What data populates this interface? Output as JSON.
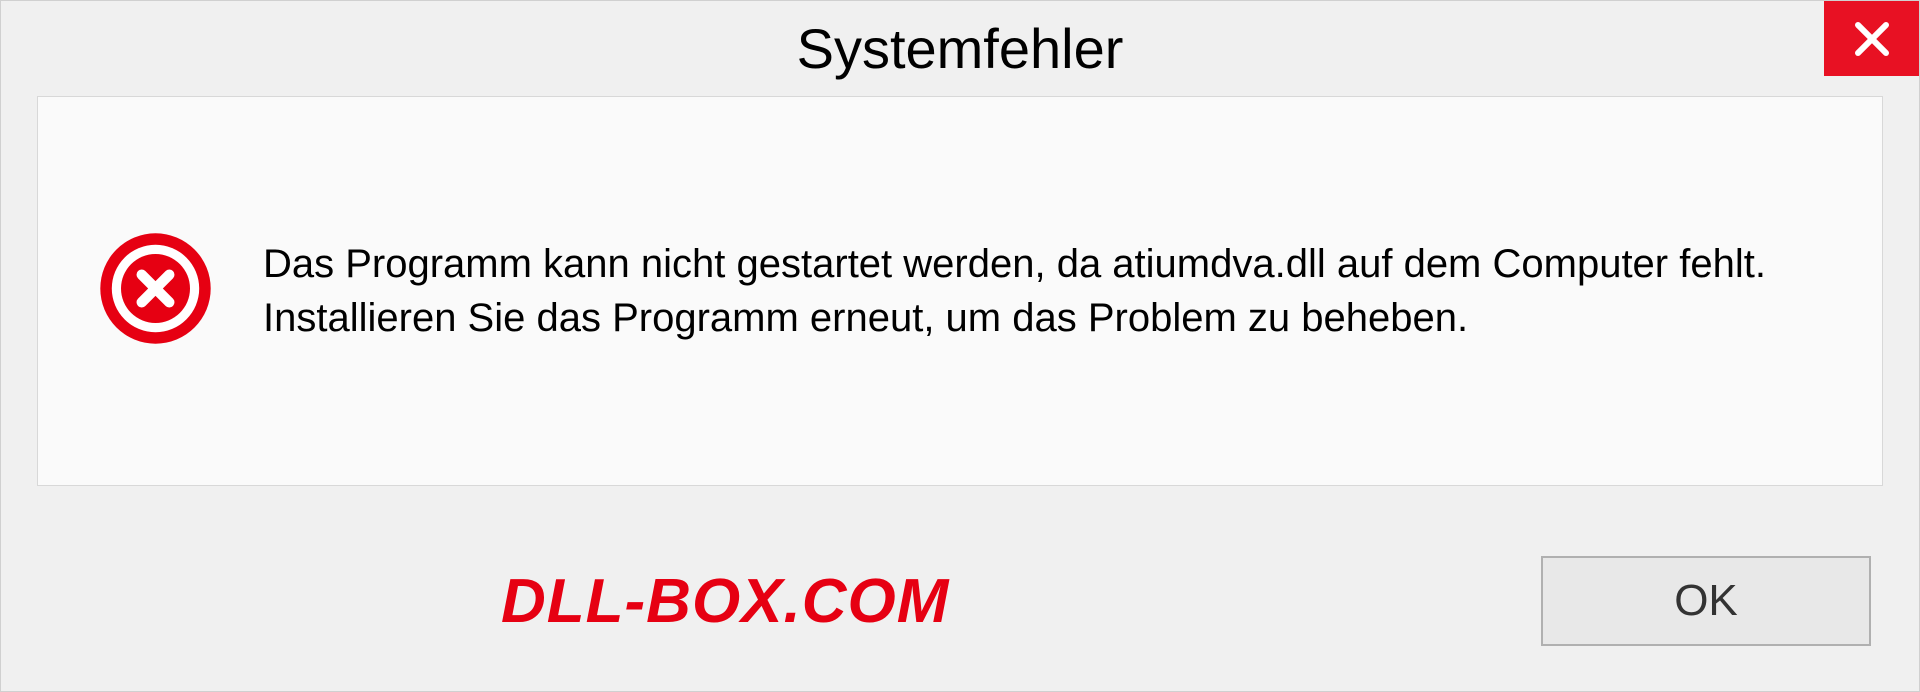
{
  "dialog": {
    "title": "Systemfehler",
    "message": "Das Programm kann nicht gestartet werden, da atiumdva.dll auf dem Computer fehlt. Installieren Sie das Programm erneut, um das Problem zu beheben.",
    "ok_label": "OK"
  },
  "watermark": "DLL-BOX.COM"
}
